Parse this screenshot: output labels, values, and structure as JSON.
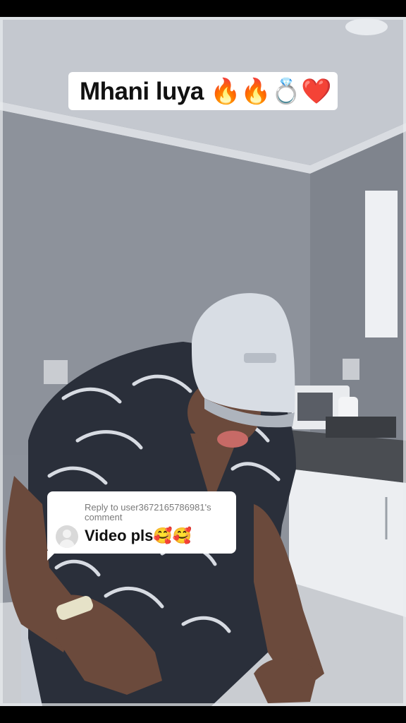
{
  "overlay": {
    "title_text": "Mhani luya 🔥🔥💍❤️"
  },
  "reply_sticker": {
    "meta": "Reply to user3672165786981's comment",
    "text": "Video pls🥰🥰"
  },
  "colors": {
    "wall": "#8e939c",
    "ceiling": "#c9ccd2",
    "floor": "#cfd2d6",
    "cabinet": "#f2f3f5",
    "cap": "#d8dde4",
    "shirt_dark": "#2a2f3a",
    "skin": "#6b4a3c"
  }
}
